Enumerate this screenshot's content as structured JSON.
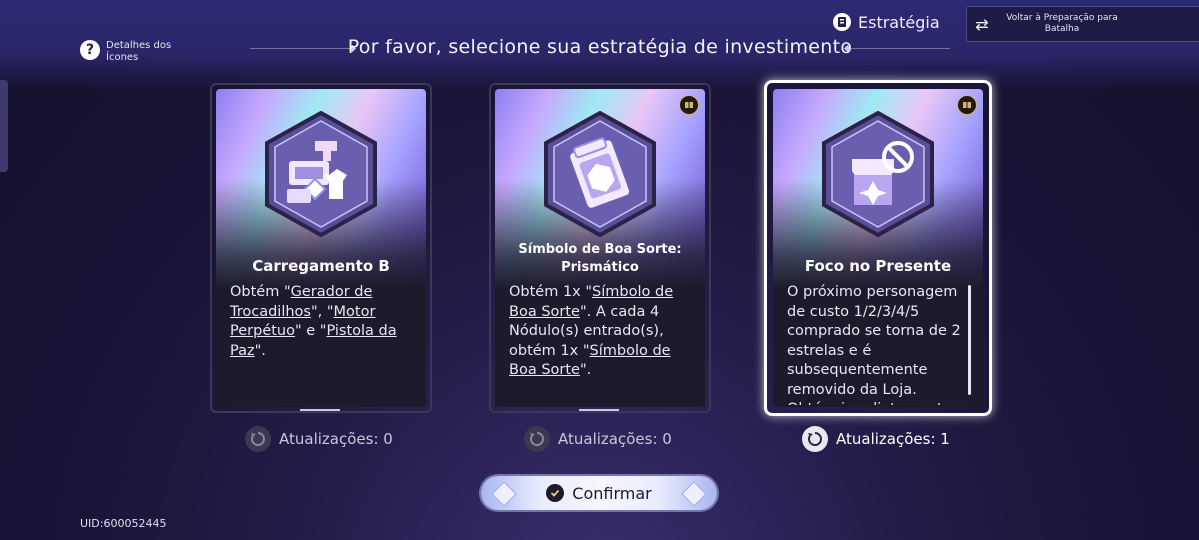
{
  "header": {
    "help_label": "Detalhes dos Ícones",
    "title": "Por favor, selecione sua estratégia de investimento",
    "strategy_label": "Estratégia",
    "back_label": "Voltar à Preparação para Batalha"
  },
  "cards": [
    {
      "name": "Carregamento B",
      "icon": "gadgets-bundle-icon",
      "desc_parts": [
        "Obtém \"",
        "Gerador de Trocadilhos",
        "\", \"",
        "Motor Perpétuo",
        "\" e \"",
        "Pistola da Paz",
        "\"."
      ],
      "refresh_label": "Atualizações: 0",
      "selected": false
    },
    {
      "name": "Símbolo de Boa Sorte: Prismático",
      "icon": "lucky-charm-icon",
      "desc_parts": [
        "Obtém 1x \"",
        "Símbolo de Boa Sorte",
        "\". A cada 4 Nódulo(s) entrado(s), obtém 1x \"",
        "Símbolo de Boa Sorte",
        "\"."
      ],
      "refresh_label": "Atualizações: 0",
      "selected": false
    },
    {
      "name": "Foco no Presente",
      "icon": "shop-restricted-icon",
      "desc": "O próximo personagem de custo 1/2/3/4/5 comprado se torna de 2 estrelas e é subsequentemente removido da Loja. Obtém imediatamente",
      "refresh_label": "Atualizações: 1",
      "selected": true
    }
  ],
  "confirm_label": "Confirmar",
  "uid": "UID:600052445",
  "colors": {
    "background": "#1a1538",
    "accent": "#8c7ff0",
    "selected_border": "#ffffff",
    "book_badge": "#d6b46a"
  }
}
